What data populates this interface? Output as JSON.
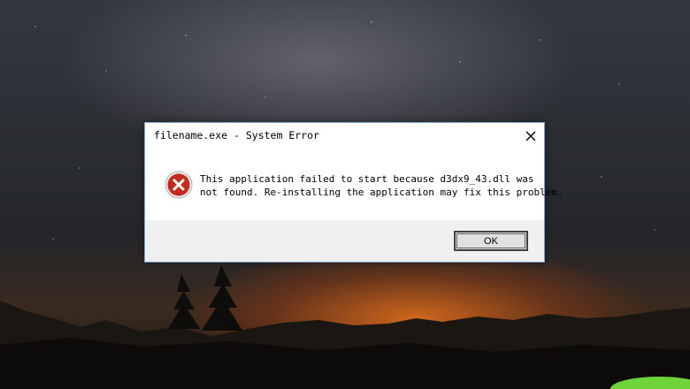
{
  "dialog": {
    "title": "filename.exe - System Error",
    "message_line1": "This application failed to start because d3dx9_43.dll was",
    "message_line2": "not found. Re-installing the application may fix this problem.",
    "ok_label": "OK",
    "icon": "error-icon",
    "close_icon": "close-icon"
  },
  "colors": {
    "error_red": "#c42b1c",
    "footer_bg": "#f0f0f0",
    "sky_glow": "#d66a1c"
  }
}
